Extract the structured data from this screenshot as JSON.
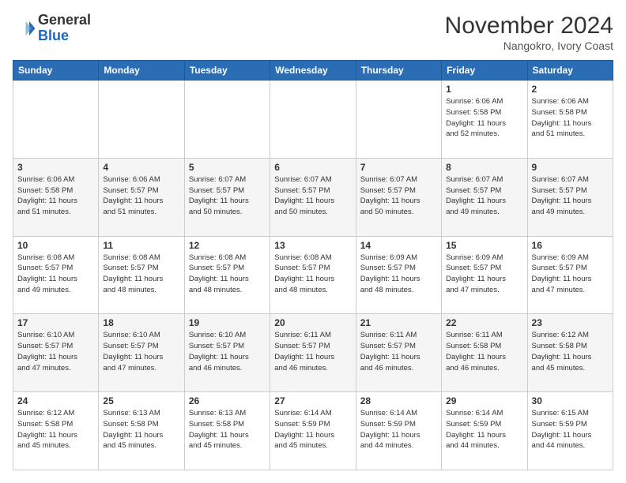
{
  "header": {
    "logo_line1": "General",
    "logo_line2": "Blue",
    "month_title": "November 2024",
    "location": "Nangokro, Ivory Coast"
  },
  "weekdays": [
    "Sunday",
    "Monday",
    "Tuesday",
    "Wednesday",
    "Thursday",
    "Friday",
    "Saturday"
  ],
  "rows": [
    [
      {
        "day": "",
        "info": ""
      },
      {
        "day": "",
        "info": ""
      },
      {
        "day": "",
        "info": ""
      },
      {
        "day": "",
        "info": ""
      },
      {
        "day": "",
        "info": ""
      },
      {
        "day": "1",
        "info": "Sunrise: 6:06 AM\nSunset: 5:58 PM\nDaylight: 11 hours\nand 52 minutes."
      },
      {
        "day": "2",
        "info": "Sunrise: 6:06 AM\nSunset: 5:58 PM\nDaylight: 11 hours\nand 51 minutes."
      }
    ],
    [
      {
        "day": "3",
        "info": "Sunrise: 6:06 AM\nSunset: 5:58 PM\nDaylight: 11 hours\nand 51 minutes."
      },
      {
        "day": "4",
        "info": "Sunrise: 6:06 AM\nSunset: 5:57 PM\nDaylight: 11 hours\nand 51 minutes."
      },
      {
        "day": "5",
        "info": "Sunrise: 6:07 AM\nSunset: 5:57 PM\nDaylight: 11 hours\nand 50 minutes."
      },
      {
        "day": "6",
        "info": "Sunrise: 6:07 AM\nSunset: 5:57 PM\nDaylight: 11 hours\nand 50 minutes."
      },
      {
        "day": "7",
        "info": "Sunrise: 6:07 AM\nSunset: 5:57 PM\nDaylight: 11 hours\nand 50 minutes."
      },
      {
        "day": "8",
        "info": "Sunrise: 6:07 AM\nSunset: 5:57 PM\nDaylight: 11 hours\nand 49 minutes."
      },
      {
        "day": "9",
        "info": "Sunrise: 6:07 AM\nSunset: 5:57 PM\nDaylight: 11 hours\nand 49 minutes."
      }
    ],
    [
      {
        "day": "10",
        "info": "Sunrise: 6:08 AM\nSunset: 5:57 PM\nDaylight: 11 hours\nand 49 minutes."
      },
      {
        "day": "11",
        "info": "Sunrise: 6:08 AM\nSunset: 5:57 PM\nDaylight: 11 hours\nand 48 minutes."
      },
      {
        "day": "12",
        "info": "Sunrise: 6:08 AM\nSunset: 5:57 PM\nDaylight: 11 hours\nand 48 minutes."
      },
      {
        "day": "13",
        "info": "Sunrise: 6:08 AM\nSunset: 5:57 PM\nDaylight: 11 hours\nand 48 minutes."
      },
      {
        "day": "14",
        "info": "Sunrise: 6:09 AM\nSunset: 5:57 PM\nDaylight: 11 hours\nand 48 minutes."
      },
      {
        "day": "15",
        "info": "Sunrise: 6:09 AM\nSunset: 5:57 PM\nDaylight: 11 hours\nand 47 minutes."
      },
      {
        "day": "16",
        "info": "Sunrise: 6:09 AM\nSunset: 5:57 PM\nDaylight: 11 hours\nand 47 minutes."
      }
    ],
    [
      {
        "day": "17",
        "info": "Sunrise: 6:10 AM\nSunset: 5:57 PM\nDaylight: 11 hours\nand 47 minutes."
      },
      {
        "day": "18",
        "info": "Sunrise: 6:10 AM\nSunset: 5:57 PM\nDaylight: 11 hours\nand 47 minutes."
      },
      {
        "day": "19",
        "info": "Sunrise: 6:10 AM\nSunset: 5:57 PM\nDaylight: 11 hours\nand 46 minutes."
      },
      {
        "day": "20",
        "info": "Sunrise: 6:11 AM\nSunset: 5:57 PM\nDaylight: 11 hours\nand 46 minutes."
      },
      {
        "day": "21",
        "info": "Sunrise: 6:11 AM\nSunset: 5:57 PM\nDaylight: 11 hours\nand 46 minutes."
      },
      {
        "day": "22",
        "info": "Sunrise: 6:11 AM\nSunset: 5:58 PM\nDaylight: 11 hours\nand 46 minutes."
      },
      {
        "day": "23",
        "info": "Sunrise: 6:12 AM\nSunset: 5:58 PM\nDaylight: 11 hours\nand 45 minutes."
      }
    ],
    [
      {
        "day": "24",
        "info": "Sunrise: 6:12 AM\nSunset: 5:58 PM\nDaylight: 11 hours\nand 45 minutes."
      },
      {
        "day": "25",
        "info": "Sunrise: 6:13 AM\nSunset: 5:58 PM\nDaylight: 11 hours\nand 45 minutes."
      },
      {
        "day": "26",
        "info": "Sunrise: 6:13 AM\nSunset: 5:58 PM\nDaylight: 11 hours\nand 45 minutes."
      },
      {
        "day": "27",
        "info": "Sunrise: 6:14 AM\nSunset: 5:59 PM\nDaylight: 11 hours\nand 45 minutes."
      },
      {
        "day": "28",
        "info": "Sunrise: 6:14 AM\nSunset: 5:59 PM\nDaylight: 11 hours\nand 44 minutes."
      },
      {
        "day": "29",
        "info": "Sunrise: 6:14 AM\nSunset: 5:59 PM\nDaylight: 11 hours\nand 44 minutes."
      },
      {
        "day": "30",
        "info": "Sunrise: 6:15 AM\nSunset: 5:59 PM\nDaylight: 11 hours\nand 44 minutes."
      }
    ]
  ]
}
